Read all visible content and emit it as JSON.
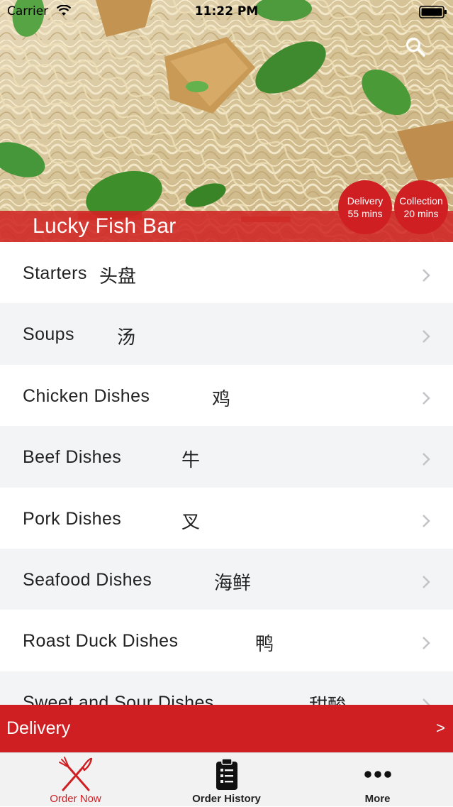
{
  "status_bar": {
    "carrier": "Carrier",
    "time": "11:22 PM"
  },
  "header": {
    "restaurant_name": "Lucky Fish Bar",
    "search_icon": "search-icon",
    "delivery_badge": {
      "label": "Delivery",
      "time": "55 mins"
    },
    "collection_badge": {
      "label": "Collection",
      "time": "20 mins"
    }
  },
  "menu": {
    "categories": [
      {
        "name": "Starters",
        "chinese": "头盘"
      },
      {
        "name": "Soups",
        "chinese": "汤"
      },
      {
        "name": "Chicken Dishes",
        "chinese": "鸡"
      },
      {
        "name": "Beef Dishes",
        "chinese": "牛"
      },
      {
        "name": "Pork Dishes",
        "chinese": "叉"
      },
      {
        "name": "Seafood Dishes",
        "chinese": "海鲜"
      },
      {
        "name": "Roast Duck Dishes",
        "chinese": "鸭"
      },
      {
        "name": "Sweet and Sour Dishes",
        "chinese": "甜酸"
      }
    ]
  },
  "order_mode_bar": {
    "label": "Delivery",
    "arrow": ">"
  },
  "tab_bar": {
    "tabs": [
      {
        "label": "Order Now",
        "icon": "fork-knife-icon",
        "active": true
      },
      {
        "label": "Order History",
        "icon": "clipboard-list-icon",
        "active": false
      },
      {
        "label": "More",
        "icon": "more-dots-icon",
        "active": false
      }
    ]
  },
  "colors": {
    "accent": "#cf1f23",
    "row_alt": "#f3f4f5",
    "tab_bar_bg": "#f2f2f2"
  }
}
